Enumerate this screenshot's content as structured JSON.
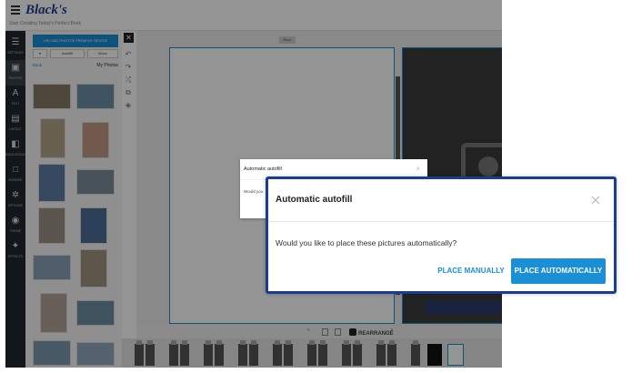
{
  "header": {
    "logo": "Black's",
    "tagline": "Start Creating Today's Perfect Book"
  },
  "rail": [
    {
      "label": "SETTINGS",
      "icon": "sliders-icon"
    },
    {
      "label": "PHOTOS",
      "icon": "image-icon"
    },
    {
      "label": "TEXT",
      "icon": "text-icon"
    },
    {
      "label": "LAYOUT",
      "icon": "layout-icon"
    },
    {
      "label": "BACKGROUND",
      "icon": "background-icon"
    },
    {
      "label": "BORDER",
      "icon": "frame-icon"
    },
    {
      "label": "OPTIONS",
      "icon": "gear-icon"
    },
    {
      "label": "THEME",
      "icon": "palette-icon"
    },
    {
      "label": "EFFECTS",
      "icon": "sparkle-icon"
    }
  ],
  "panel": {
    "upload_label": "UPLOAD PHOTOS FROM MY DEVICE",
    "autofill_label": "Autofill",
    "move_label": "Move",
    "back_label": "Back",
    "title": "My Photos"
  },
  "workspace": {
    "page_label": "Back"
  },
  "pager": {
    "prev": "‹",
    "next": "›",
    "rearrange_label": "REARRANGE"
  },
  "small_dialog": {
    "title": "Automatic autofill",
    "body": "Would you",
    "close": "×"
  },
  "dialog": {
    "title": "Automatic autofill",
    "body": "Would you like to place these pictures automatically?",
    "manual_label": "PLACE MANUALLY",
    "auto_label": "PLACE AUTOMATICALLY",
    "accent_color": "#1a8fd6",
    "border_color": "#1b3d91"
  }
}
